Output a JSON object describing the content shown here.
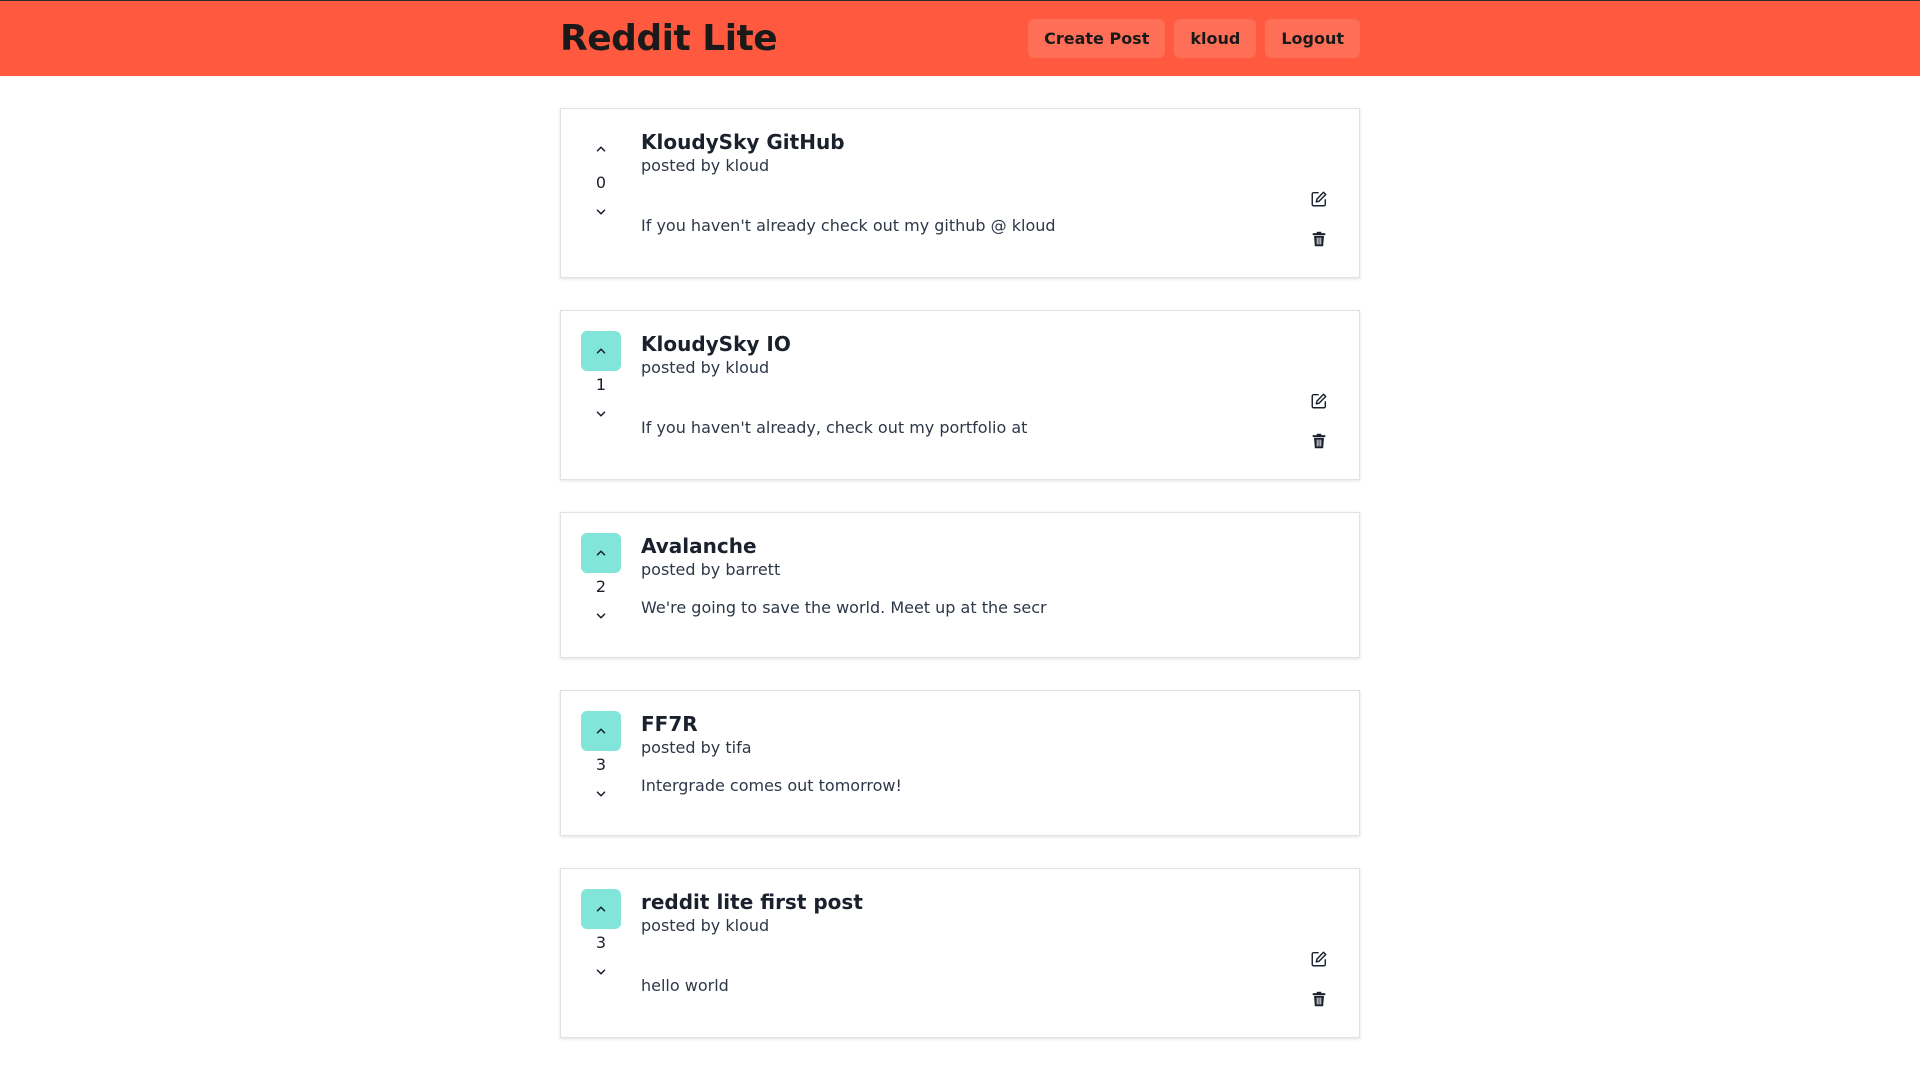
{
  "app": {
    "title": "Reddit Lite"
  },
  "nav": {
    "create_post": "Create Post",
    "user": "kloud",
    "logout": "Logout"
  },
  "colors": {
    "header": "#ff5a3f",
    "nav_button": "#ff6e56",
    "vote_active": "#81e6d9"
  },
  "posts": [
    {
      "title": "KloudySky GitHub",
      "author": "posted by kloud",
      "score": "0",
      "body": "If you haven't already check out my github @ kloud",
      "upvoted": false,
      "owned": true
    },
    {
      "title": "KloudySky IO",
      "author": "posted by kloud",
      "score": "1",
      "body": "If you haven't already, check out my portfolio at",
      "upvoted": true,
      "owned": true
    },
    {
      "title": "Avalanche",
      "author": "posted by barrett",
      "score": "2",
      "body": "We're going to save the world. Meet up at the secr",
      "upvoted": true,
      "owned": false
    },
    {
      "title": "FF7R",
      "author": "posted by tifa",
      "score": "3",
      "body": "Intergrade comes out tomorrow!",
      "upvoted": true,
      "owned": false
    },
    {
      "title": "reddit lite first post",
      "author": "posted by kloud",
      "score": "3",
      "body": "hello world",
      "upvoted": true,
      "owned": true
    }
  ]
}
